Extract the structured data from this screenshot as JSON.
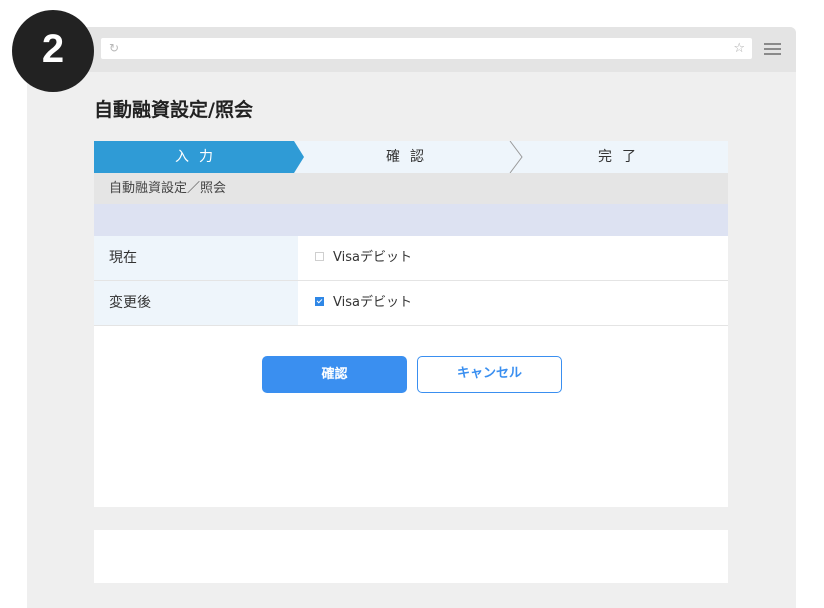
{
  "step_badge": "2",
  "browser": {
    "reload_icon": "↻",
    "star_icon": "☆"
  },
  "page_title": "自動融資設定/照会",
  "steps": [
    {
      "label": "入力",
      "active": true
    },
    {
      "label": "確認",
      "active": false
    },
    {
      "label": "完了",
      "active": false
    }
  ],
  "section_header": "自動融資設定／照会",
  "rows": [
    {
      "label": "現在",
      "value": "Visaデビット",
      "checked": false
    },
    {
      "label": "変更後",
      "value": "Visaデビット",
      "checked": true
    }
  ],
  "buttons": {
    "confirm": "確認",
    "cancel": "キャンセル"
  },
  "colors": {
    "accent": "#2f87e6",
    "step_active": "#2f9bd6",
    "step_bg": "#eef5fb",
    "lavender": "#dde2f2"
  }
}
